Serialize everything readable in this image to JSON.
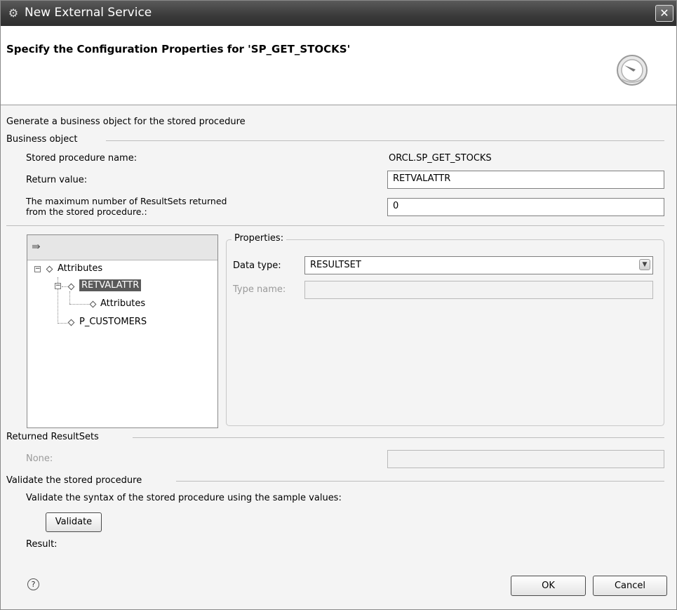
{
  "window": {
    "title": "New External Service",
    "close_symbol": "✕",
    "app_icon": "wizard-app-icon"
  },
  "header": {
    "heading": "Specify the Configuration Properties for 'SP_GET_STOCKS'",
    "icon": "gauge-icon"
  },
  "intro_text": "Generate a business object for the stored procedure",
  "business_object": {
    "group_label": "Business object",
    "stored_procedure_name_label": "Stored procedure name:",
    "stored_procedure_name_value": "ORCL.SP_GET_STOCKS",
    "return_value_label": "Return value:",
    "return_value": "RETVALATTR",
    "max_resultsets_label_line1": "The maximum number of ResultSets returned",
    "max_resultsets_label_line2": "from the stored procedure.:",
    "max_resultsets_value": "0"
  },
  "tree": {
    "toolbar_icon": "collapse-all-icon",
    "nodes": [
      {
        "label": "Attributes"
      },
      {
        "label": "RETVALATTR"
      },
      {
        "label": "Attributes"
      },
      {
        "label": "P_CUSTOMERS"
      }
    ]
  },
  "properties": {
    "group_label": "Properties:",
    "data_type_label": "Data type:",
    "data_type_value": "RESULTSET",
    "type_name_label": "Type name:",
    "type_name_value": ""
  },
  "returned_resultsets": {
    "group_label": "Returned ResultSets",
    "none_label": "None:",
    "none_value": ""
  },
  "validate": {
    "group_label": "Validate the stored procedure",
    "description": "Validate the syntax of the stored procedure using the sample values:",
    "button_label": "Validate",
    "result_label": "Result:"
  },
  "footer": {
    "help_symbol": "?",
    "ok_label": "OK",
    "cancel_label": "Cancel"
  }
}
